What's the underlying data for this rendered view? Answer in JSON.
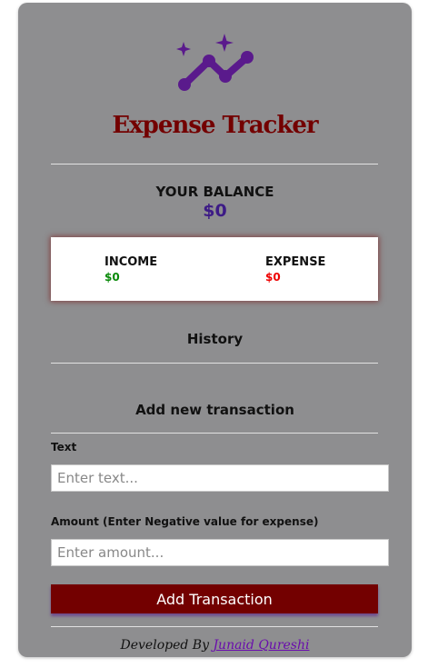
{
  "app": {
    "title": "Expense Tracker"
  },
  "balance": {
    "label": "YOUR BALANCE",
    "value": "$0"
  },
  "summary": {
    "income_label": "INCOME",
    "income_value": "$0",
    "expense_label": "EXPENSE",
    "expense_value": "$0"
  },
  "history": {
    "heading": "History"
  },
  "form": {
    "heading": "Add new transaction",
    "text_label": "Text",
    "text_placeholder": "Enter text...",
    "amount_label": "Amount (Enter Negative value for expense)",
    "amount_placeholder": "Enter amount...",
    "submit_label": "Add Transaction"
  },
  "footer": {
    "prefix": "Developed By",
    "author": "Junaid Qureshi"
  },
  "icons": {
    "logo": "trend-line-sparkle-icon"
  },
  "colors": {
    "card_bg": "#8e8e90",
    "title": "#730000",
    "balance": "#3d1b86",
    "income": "#0a8a0a",
    "expense": "#ee0000",
    "button_bg": "#730000",
    "logo": "#5a1a8c",
    "author_link": "#6a0dad"
  }
}
